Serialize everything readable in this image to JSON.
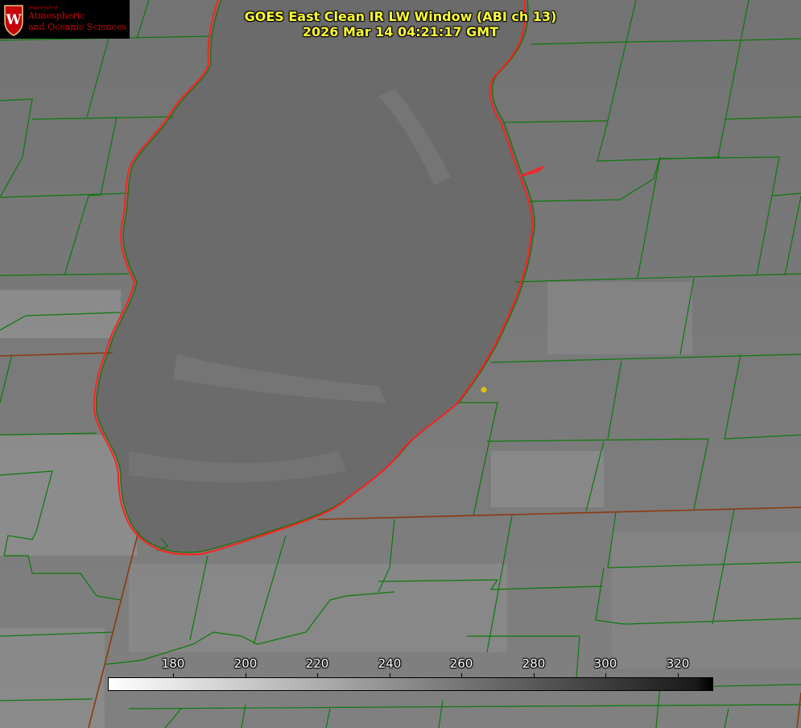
{
  "title": {
    "line1": "GOES East Clean IR LW Window (ABI ch 13)",
    "line2": "2026 Mar 14 04:21:17 GMT"
  },
  "logo": {
    "department": "Department of",
    "line1": "Atmospheric",
    "line2": "and Oceanic Sciences",
    "crest_letter": "W"
  },
  "colorbar": {
    "ticks": [
      "180",
      "200",
      "220",
      "240",
      "260",
      "280",
      "300",
      "320"
    ]
  },
  "colors": {
    "lake_outline": "#ff2020",
    "county_lines": "#0a7a0a",
    "state_lines": "#8b3a0f",
    "title_text": "#ffff33",
    "marker": "#e0c000"
  }
}
